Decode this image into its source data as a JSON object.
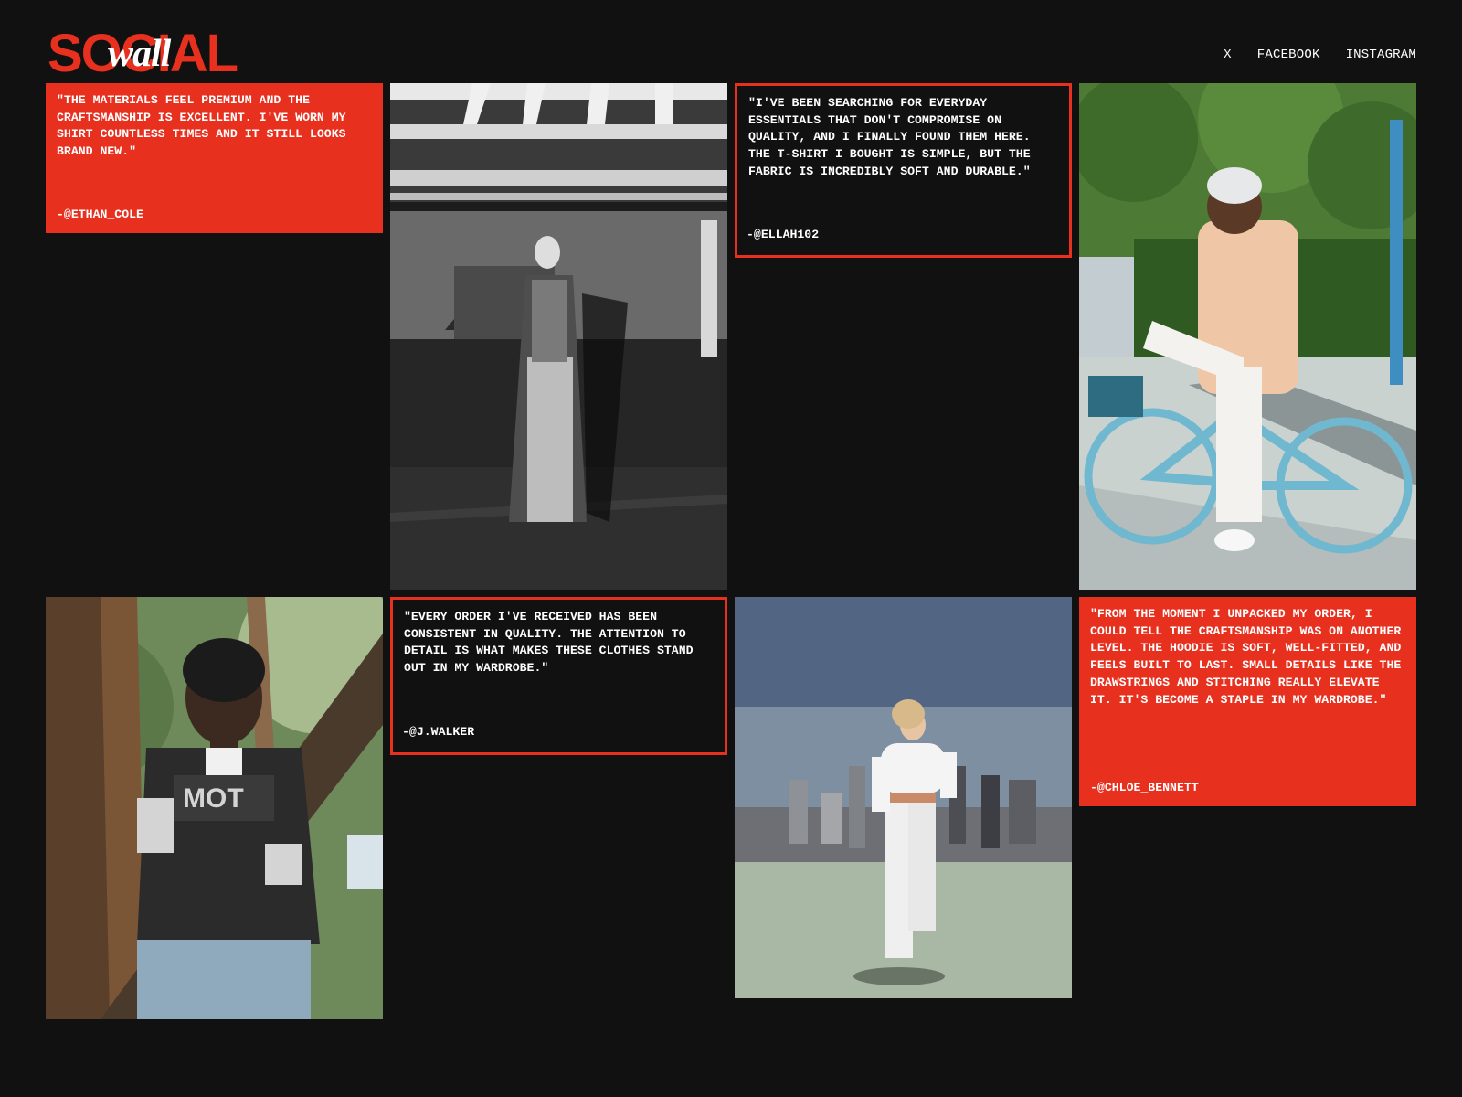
{
  "brand": {
    "word": "SOCIAL",
    "script": "wall",
    "accent_color": "#e8301f",
    "background_color": "#111111"
  },
  "nav": {
    "items": [
      "X",
      "FACEBOOK",
      "INSTAGRAM"
    ]
  },
  "testimonials": [
    {
      "quote": "\"THE MATERIALS FEEL PREMIUM AND THE CRAFTSMANSHIP IS EXCELLENT. I'VE WORN MY SHIRT COUNTLESS TIMES AND IT STILL LOOKS BRAND NEW.\"",
      "author": "-@ETHAN_COLE",
      "style": "filled"
    },
    {
      "quote": "\"I'VE BEEN SEARCHING FOR EVERYDAY ESSENTIALS THAT DON'T COMPROMISE ON QUALITY, AND I FINALLY FOUND THEM HERE. THE T-SHIRT I BOUGHT IS SIMPLE, BUT THE FABRIC IS INCREDIBLY SOFT AND DURABLE.\"",
      "author": "-@ELLAH102",
      "style": "outline"
    },
    {
      "quote": "\"EVERY ORDER I'VE RECEIVED HAS BEEN CONSISTENT IN QUALITY. THE ATTENTION TO DETAIL IS WHAT MAKES THESE CLOTHES STAND OUT IN MY WARDROBE.\"",
      "author": "-@J.WALKER",
      "style": "outline"
    },
    {
      "quote": "\"FROM THE MOMENT I UNPACKED MY ORDER, I COULD TELL THE CRAFTSMANSHIP WAS ON ANOTHER LEVEL. THE HOODIE IS SOFT, WELL-FITTED, AND FEELS BUILT TO LAST. SMALL DETAILS LIKE THE DRAWSTRINGS AND STITCHING REALLY ELEVATE IT. IT'S BECOME A STAPLE IN MY WARDROBE.\"",
      "author": "-@CHLOE_BENNETT",
      "style": "filled"
    }
  ],
  "photos": [
    {
      "name": "photo-bw-corridor",
      "colors": [
        "#2a2a2a",
        "#8c8c8c",
        "#e6e6e6"
      ]
    },
    {
      "name": "photo-man-bicycle",
      "colors": [
        "#3f6b2a",
        "#c9d2cf",
        "#6fb8cf",
        "#f0c7a6"
      ]
    },
    {
      "name": "photo-man-tree",
      "colors": [
        "#4a3a2c",
        "#6f8a5a",
        "#2b2b2b",
        "#a8bccf"
      ]
    },
    {
      "name": "photo-woman-running",
      "colors": [
        "#556a86",
        "#a9b8a5",
        "#f2f2f2",
        "#6d6f75"
      ]
    }
  ]
}
